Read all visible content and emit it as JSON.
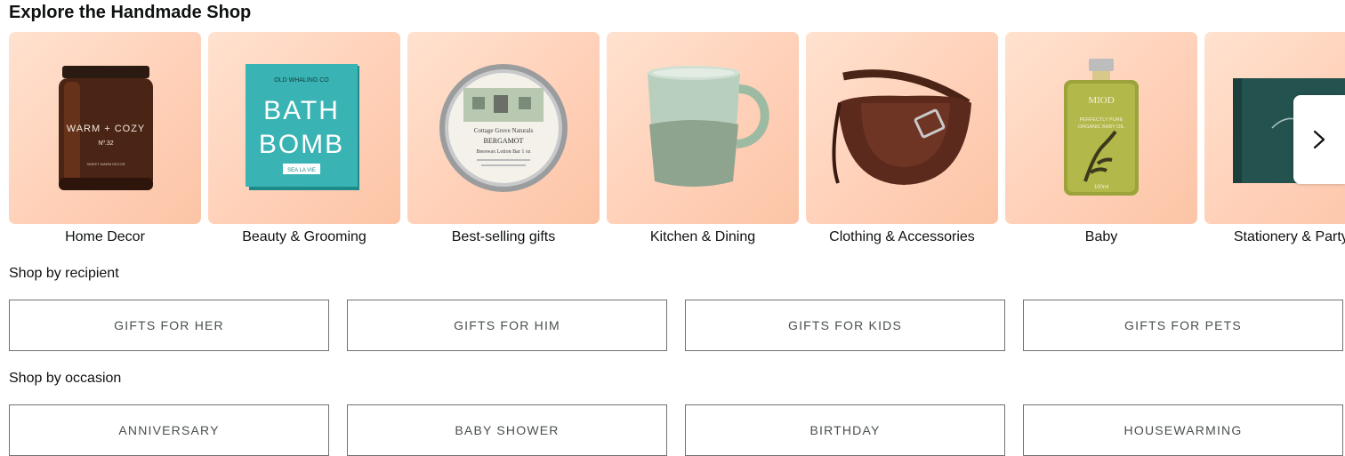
{
  "header": {
    "title": "Explore the Handmade Shop"
  },
  "categories": [
    {
      "label": "Home Decor",
      "image_text_1": "WARM + COZY",
      "image_text_2": "Nº.32",
      "image_text_3": "SWEET WARM DECOR"
    },
    {
      "label": "Beauty & Grooming",
      "image_text_1": "OLD WHALING CO",
      "image_text_2": "BATH",
      "image_text_3": "BOMB",
      "image_text_4": "SEA LA VIE"
    },
    {
      "label": "Best-selling gifts",
      "image_text_1": "Cottage Grove Naturals",
      "image_text_2": "BERGAMOT",
      "image_text_3": "Beeswax Lotion Bar 1 oz"
    },
    {
      "label": "Kitchen & Dining"
    },
    {
      "label": "Clothing & Accessories"
    },
    {
      "label": "Baby",
      "image_text_1": "MIOD",
      "image_text_2": "PERFECTLY PURE",
      "image_text_3": "ORGANIC BABY OIL",
      "image_text_4": "100ml"
    },
    {
      "label": "Stationery & Party su"
    }
  ],
  "carousel": {
    "next_icon": "chevron-right-icon"
  },
  "recipient": {
    "heading": "Shop by recipient",
    "buttons": [
      "GIFTS FOR HER",
      "GIFTS FOR HIM",
      "GIFTS FOR KIDS",
      "GIFTS FOR PETS"
    ]
  },
  "occasion": {
    "heading": "Shop by occasion",
    "buttons": [
      "ANNIVERSARY",
      "BABY SHOWER",
      "BIRTHDAY",
      "HOUSEWARMING"
    ]
  },
  "colors": {
    "tile_bg": "#ffd5bd",
    "text": "#0f1111",
    "pill_border": "#6f7373"
  }
}
